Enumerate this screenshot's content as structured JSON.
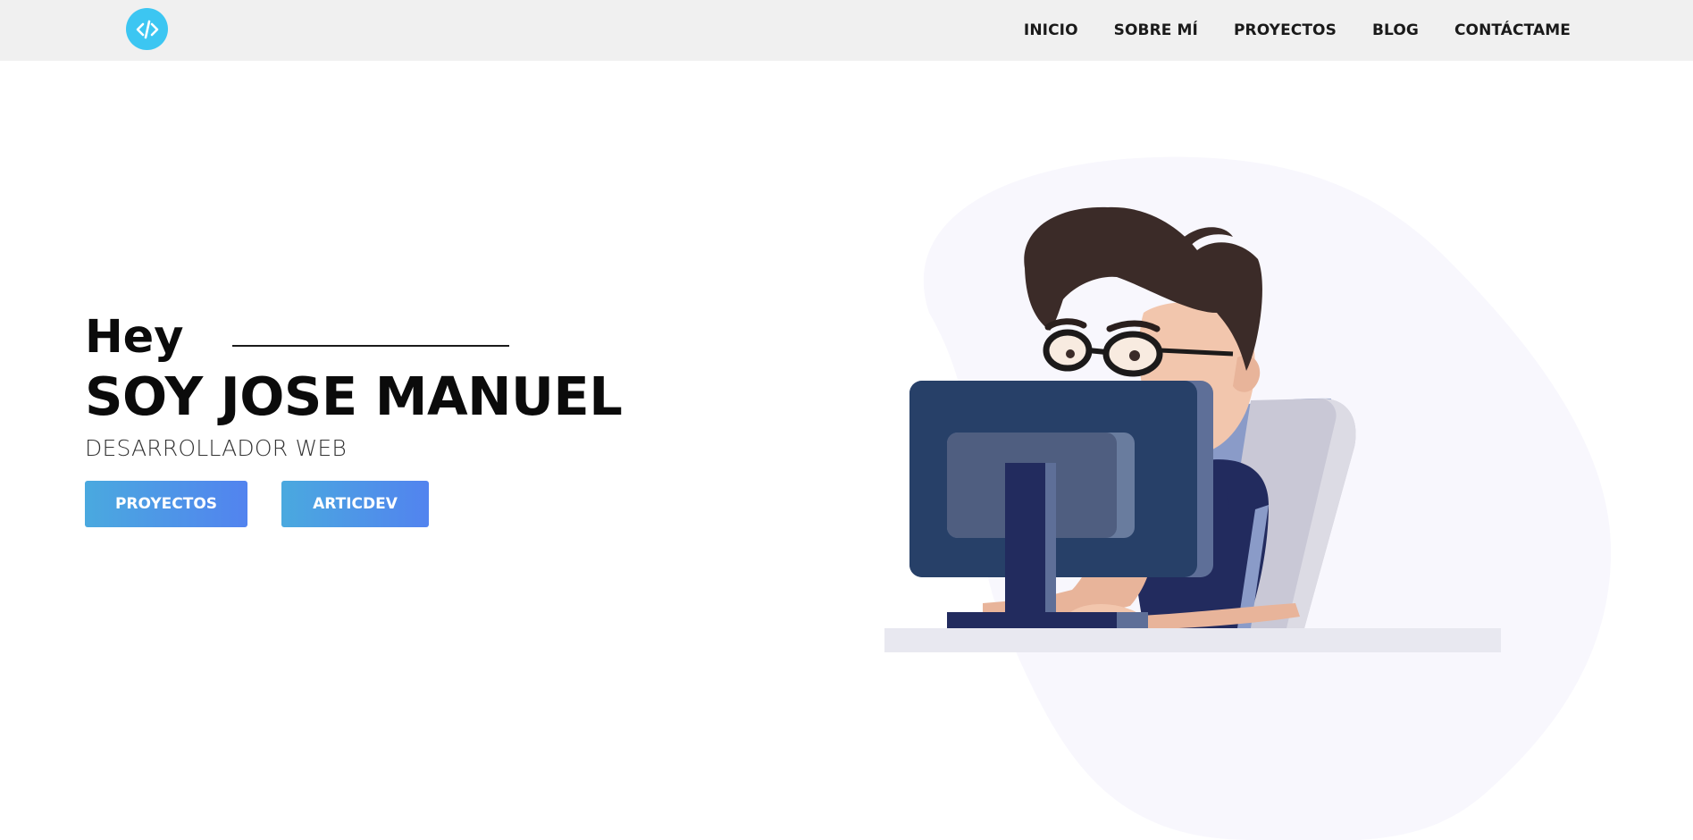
{
  "nav": {
    "logo_icon": "code-brackets-icon",
    "links": [
      "INICIO",
      "SOBRE MÍ",
      "PROYECTOS",
      "BLOG",
      "CONTÁCTAME"
    ]
  },
  "hero": {
    "greeting": "Hey",
    "name": "SOY JOSE MANUEL",
    "role": "DESARROLLADOR WEB",
    "buttons": [
      "PROYECTOS",
      "ARTICDEV"
    ]
  },
  "colors": {
    "logo": "#3cc6f2",
    "nav_background": "#f0f0f0",
    "button_gradient_start": "#4aa9df",
    "button_gradient_end": "#5283ef"
  }
}
